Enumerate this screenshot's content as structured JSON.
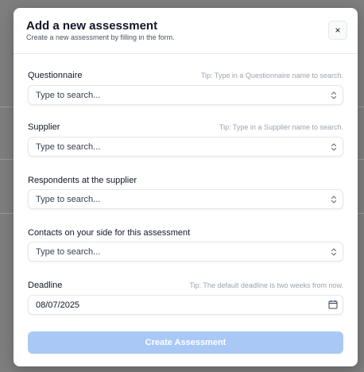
{
  "modal": {
    "title": "Add a new assessment",
    "subtitle": "Create a new assessment by filling in the form.",
    "close_icon": "×"
  },
  "fields": {
    "questionnaire": {
      "label": "Questionnaire",
      "tip": "Tip: Type in a Questionnaire name to search.",
      "placeholder": "Type to search..."
    },
    "supplier": {
      "label": "Supplier",
      "tip": "Tip: Type in a Supplier name to search.",
      "placeholder": "Type to search..."
    },
    "respondents": {
      "label": "Respondents at the supplier",
      "placeholder": "Type to search..."
    },
    "contacts": {
      "label": "Contacts on your side for this assessment",
      "placeholder": "Type to search..."
    },
    "deadline": {
      "label": "Deadline",
      "tip": "Tip: The default deadline is two weeks from now.",
      "value": "08/07/2025"
    }
  },
  "actions": {
    "submit_label": "Create Assessment"
  },
  "icons": {
    "select_chevron": "chevron-up-down-icon",
    "date_picker": "calendar-icon",
    "close": "close-icon"
  },
  "colors": {
    "submit_disabled_bg": "#a9c8f6",
    "overlay": "#7e7e7e"
  }
}
